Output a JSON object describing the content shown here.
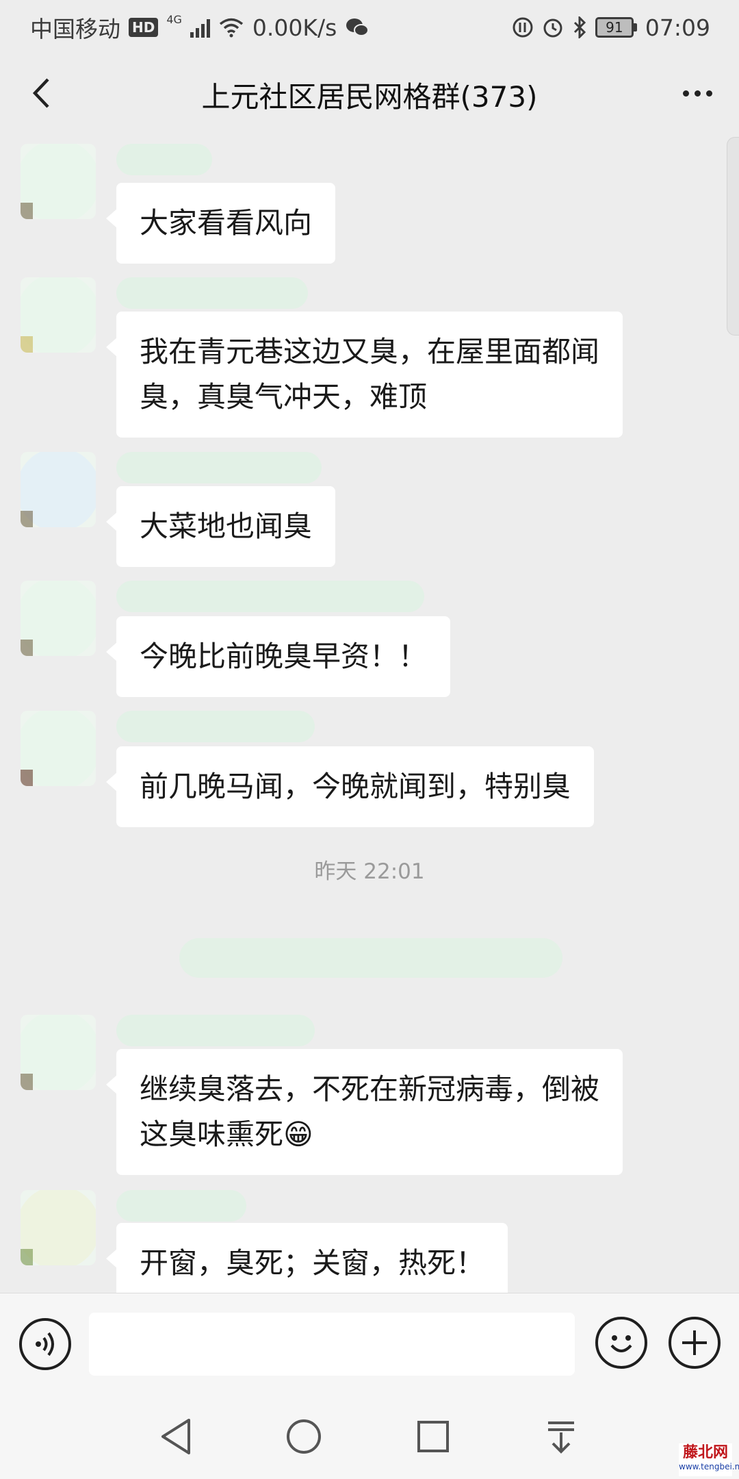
{
  "status_bar": {
    "carrier": "中国移动",
    "hd_badge": "HD",
    "network": "4G",
    "speed": "0.00K/s",
    "battery": "91",
    "time": "07:09"
  },
  "header": {
    "title": "上元社区居民网格群(373)"
  },
  "messages": [
    {
      "text": "大家看看风向"
    },
    {
      "text": "我在青元巷这边又臭，在屋里面都闻臭，真臭气冲天，难顶"
    },
    {
      "text": "大菜地也闻臭"
    },
    {
      "text": "今晚比前晚臭早资！！"
    },
    {
      "text": "前几晚马闻，今晚就闻到，特别臭"
    },
    {
      "text": "继续臭落去，不死在新冠病毒，倒被这臭味熏死😁"
    },
    {
      "text": "开窗，臭死；关窗，热死！"
    }
  ],
  "timestamp": "昨天 22:01",
  "watermark": {
    "name": "藤北网",
    "url": "www.tengbei.net"
  },
  "icons": {
    "back": "chevron-left-icon",
    "more": "more-dots-icon",
    "voice": "voice-icon",
    "emoji": "emoji-icon",
    "plus": "plus-icon"
  },
  "colors": {
    "background": "#ededed",
    "bubble": "#ffffff",
    "timestamp": "#9a9a9a"
  }
}
